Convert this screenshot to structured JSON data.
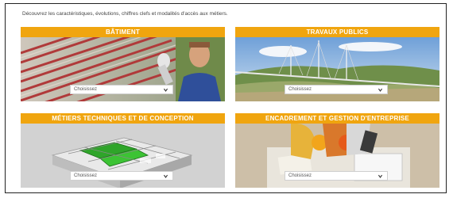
{
  "intro_text": "Découvrez les caractéristiques, évolutions, chiffres clefs et modalités d'accès aux métiers.",
  "cards": [
    {
      "title": "BÂTIMENT",
      "select_value": "Choisissez"
    },
    {
      "title": "TRAVAUX PUBLICS",
      "select_value": "Choisissez"
    },
    {
      "title": "MÉTIERS TECHNIQUES ET DE CONCEPTION",
      "select_value": "Choisissez"
    },
    {
      "title": "ENCADREMENT ET GESTION D'ENTREPRISE",
      "select_value": "Choisissez"
    }
  ],
  "colors": {
    "banner": "#f0a50f",
    "banner_text": "#ffffff"
  },
  "icons": {
    "select_chevron": "chevron-down-icon"
  }
}
